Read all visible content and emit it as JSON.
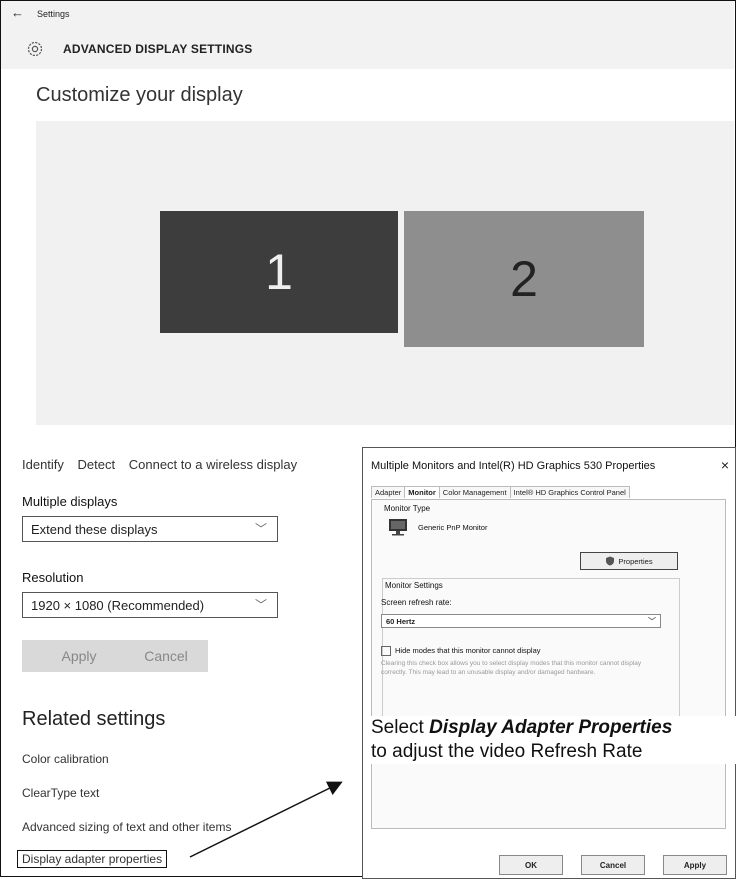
{
  "header": {
    "back_icon": "←",
    "settings_label": "Settings",
    "title": "ADVANCED DISPLAY SETTINGS"
  },
  "main": {
    "heading": "Customize your display",
    "monitors": [
      "1",
      "2"
    ],
    "links": [
      "Identify",
      "Detect",
      "Connect to a wireless display"
    ],
    "multiple_displays": {
      "label": "Multiple displays",
      "value": "Extend these displays"
    },
    "resolution": {
      "label": "Resolution",
      "value": "1920 × 1080 (Recommended)"
    },
    "apply": "Apply",
    "cancel": "Cancel",
    "related_heading": "Related settings",
    "related_links": [
      "Color calibration",
      "ClearType text",
      "Advanced sizing of text and other items",
      "Display adapter properties"
    ]
  },
  "dialog": {
    "title": "Multiple Monitors and Intel(R) HD Graphics 530 Properties",
    "close_icon": "×",
    "tabs": [
      "Adapter",
      "Monitor",
      "Color Management",
      "Intel® HD Graphics Control Panel"
    ],
    "monitor_type_label": "Monitor Type",
    "monitor_name": "Generic PnP Monitor",
    "properties_button": "Properties",
    "monitor_settings_label": "Monitor Settings",
    "refresh_label": "Screen refresh rate:",
    "refresh_value": "60 Hertz",
    "hide_modes_label": "Hide modes that this monitor cannot display",
    "hint": "Clearing this check box allows you to select display modes that this monitor cannot display correctly. This may lead to an unusable display and/or damaged hardware.",
    "ok": "OK",
    "cancel": "Cancel",
    "apply": "Apply"
  },
  "caption": {
    "prefix": "Select ",
    "emphasis": "Display Adapter Properties",
    "suffix": "to adjust the video Refresh Rate"
  }
}
